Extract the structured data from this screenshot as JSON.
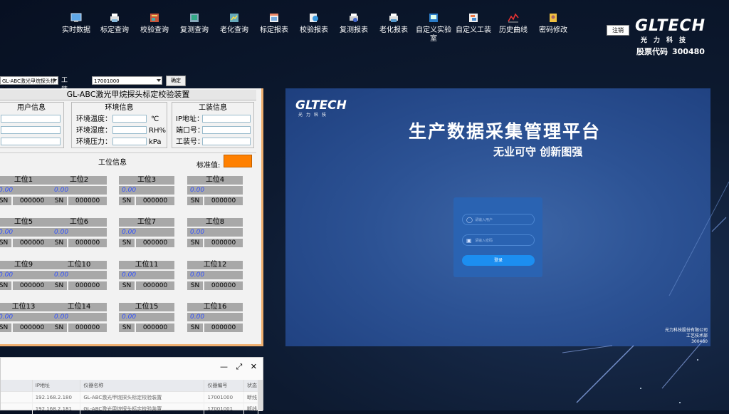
{
  "toolbar": {
    "items": [
      {
        "label": "实时数据",
        "icon": "monitor-icon"
      },
      {
        "label": "标定查询",
        "icon": "printer-icon"
      },
      {
        "label": "校验查询",
        "icon": "book-icon"
      },
      {
        "label": "复测查询",
        "icon": "report-icon"
      },
      {
        "label": "老化查询",
        "icon": "chart-doc-icon"
      },
      {
        "label": "标定报表",
        "icon": "table-icon"
      },
      {
        "label": "校验报表",
        "icon": "search-doc-icon"
      },
      {
        "label": "复测报表",
        "icon": "print-report-icon"
      },
      {
        "label": "老化报表",
        "icon": "print-icon"
      },
      {
        "label": "自定义实验室",
        "icon": "lab-icon"
      },
      {
        "label": "自定义工装",
        "icon": "tool-icon"
      },
      {
        "label": "历史曲线",
        "icon": "curve-icon"
      },
      {
        "label": "密码修改",
        "icon": "key-icon"
      }
    ]
  },
  "header": {
    "logout_label": "注销",
    "logo_text": "GLTECH",
    "logo_sub": "光力科技",
    "stock_label": "股票代码",
    "stock_code": "300480"
  },
  "selector": {
    "device_value": "GL-ABC激光甲烷探头标定",
    "fixture_label": "工装编号",
    "fixture_value": "17001000",
    "confirm_label": "确定"
  },
  "panel": {
    "title": "GL-ABC激光甲烷探头标定校验装置",
    "user_info_title": "用户信息",
    "env_info_title": "环境信息",
    "fixture_info_title": "工装信息",
    "env_fields": [
      {
        "label": "环境温度：",
        "unit": "℃"
      },
      {
        "label": "环境湿度：",
        "unit": "RH%"
      },
      {
        "label": "环境压力：",
        "unit": "kPa"
      }
    ],
    "fixture_fields": [
      {
        "label": "IP地址："
      },
      {
        "label": "端口号："
      },
      {
        "label": "工装号："
      }
    ],
    "station_info_title": "工位信息",
    "standard_label": "标准值:",
    "standard_color": "#ff8000",
    "stations": [
      {
        "name": "工位1",
        "value": "0.00",
        "sn_label": "SN",
        "sn": "000000"
      },
      {
        "name": "工位2",
        "value": "0.00",
        "sn_label": "SN",
        "sn": "000000"
      },
      {
        "name": "工位3",
        "value": "0.00",
        "sn_label": "SN",
        "sn": "000000"
      },
      {
        "name": "工位4",
        "value": "0.00",
        "sn_label": "SN",
        "sn": "000000"
      },
      {
        "name": "工位5",
        "value": "0.00",
        "sn_label": "SN",
        "sn": "000000"
      },
      {
        "name": "工位6",
        "value": "0.00",
        "sn_label": "SN",
        "sn": "000000"
      },
      {
        "name": "工位7",
        "value": "0.00",
        "sn_label": "SN",
        "sn": "000000"
      },
      {
        "name": "工位8",
        "value": "0.00",
        "sn_label": "SN",
        "sn": "000000"
      },
      {
        "name": "工位9",
        "value": "0.00",
        "sn_label": "SN",
        "sn": "000000"
      },
      {
        "name": "工位10",
        "value": "0.00",
        "sn_label": "SN",
        "sn": "000000"
      },
      {
        "name": "工位11",
        "value": "0.00",
        "sn_label": "SN",
        "sn": "000000"
      },
      {
        "name": "工位12",
        "value": "0.00",
        "sn_label": "SN",
        "sn": "000000"
      },
      {
        "name": "工位13",
        "value": "0.00",
        "sn_label": "SN",
        "sn": "000000"
      },
      {
        "name": "工位14",
        "value": "0.00",
        "sn_label": "SN",
        "sn": "000000"
      },
      {
        "name": "工位15",
        "value": "0.00",
        "sn_label": "SN",
        "sn": "000000"
      },
      {
        "name": "工位16",
        "value": "0.00",
        "sn_label": "SN",
        "sn": "000000"
      }
    ]
  },
  "table": {
    "columns": [
      "IP地址",
      "仪器名称",
      "仪器编号",
      "状态"
    ],
    "rows": [
      [
        "192.168.2.180",
        "GL-ABC激光甲烷探头标定校验装置",
        "17001000",
        "断线"
      ],
      [
        "192.168.2.181",
        "GL-ABC激光甲烷探头标定校验装置",
        "17001001",
        "断线"
      ]
    ]
  },
  "preview": {
    "logo_text": "GLTECH",
    "logo_sub": "光力科技",
    "title": "生产数据采集管理平台",
    "slogan": "无业可守 创新图强",
    "username_placeholder": "请输入用户",
    "password_placeholder": "请输入密码",
    "login_label": "登录",
    "footer_company": "光力科技股份有限公司",
    "footer_dept": "工艺技术部",
    "footer_code": "300480"
  },
  "colors": {
    "standard_indicator": "#ff8000",
    "station_value_text": "#3050ff",
    "panel_border": "#f0b070"
  }
}
